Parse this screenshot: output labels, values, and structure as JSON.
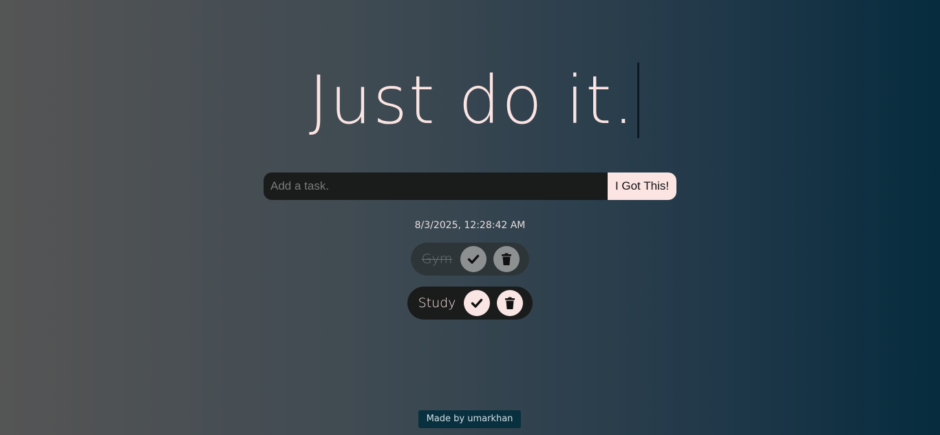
{
  "header": {
    "title": "Just do it."
  },
  "form": {
    "input_placeholder": "Add a task.",
    "input_value": "",
    "submit_label": "I Got This!"
  },
  "datetime": "8/3/2025, 12:28:42 AM",
  "tasks": [
    {
      "text": "Gym",
      "completed": true,
      "check_icon": "check-icon",
      "delete_icon": "trash-icon"
    },
    {
      "text": "Study",
      "completed": false,
      "check_icon": "check-icon",
      "delete_icon": "trash-icon"
    }
  ],
  "footer": {
    "credit": "Made by umarkhan"
  },
  "colors": {
    "accent": "#fbe4e2",
    "input_bg": "#1a1c1c",
    "task_bg": "#1a1b1b",
    "task_done_bg": "#2e3538",
    "footer_bg": "#09303f"
  }
}
